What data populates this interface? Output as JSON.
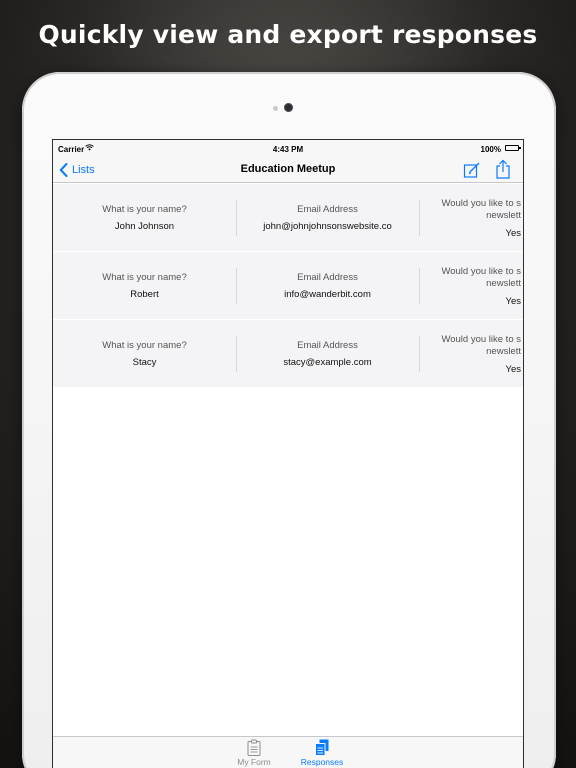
{
  "banner": {
    "headline": "Quickly view and export responses"
  },
  "status_bar": {
    "carrier": "Carrier",
    "time": "4:43 PM",
    "battery": "100%"
  },
  "nav": {
    "back_label": "Lists",
    "title": "Education Meetup",
    "icons": {
      "back": "chevron-left-icon",
      "compose": "compose-icon",
      "share": "share-icon"
    }
  },
  "responses": [
    {
      "name_question": "What is your name?",
      "name_answer": "John Johnson",
      "email_question": "Email Address",
      "email_answer": "john@johnjohnsonswebsite.co",
      "newsletter_question_line1": "Would you like to s",
      "newsletter_question_line2": "newslett",
      "newsletter_answer": "Yes"
    },
    {
      "name_question": "What is your name?",
      "name_answer": "Robert",
      "email_question": "Email Address",
      "email_answer": "info@wanderbit.com",
      "newsletter_question_line1": "Would you like to s",
      "newsletter_question_line2": "newslett",
      "newsletter_answer": "Yes"
    },
    {
      "name_question": "What is your name?",
      "name_answer": "Stacy",
      "email_question": "Email Address",
      "email_answer": "stacy@example.com",
      "newsletter_question_line1": "Would you like to s",
      "newsletter_question_line2": "newslett",
      "newsletter_answer": "Yes"
    }
  ],
  "tabs": [
    {
      "label": "My Form",
      "icon": "clipboard-icon",
      "selected": false
    },
    {
      "label": "Responses",
      "icon": "documents-icon",
      "selected": true
    }
  ],
  "colors": {
    "accent": "#0a7aff",
    "inactive_tab": "#8e8e93",
    "row_background": "#f4f4f6"
  }
}
